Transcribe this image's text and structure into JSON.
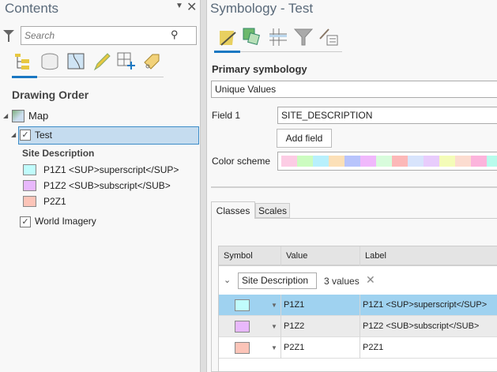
{
  "contents": {
    "title": "Contents",
    "search_placeholder": "Search",
    "section": "Drawing Order",
    "tree": {
      "map": "Map",
      "layer": "Test",
      "legend_heading": "Site Description",
      "legend": [
        {
          "label": "P1Z1 <SUP>superscript</SUP>",
          "color": "#c0fcfc"
        },
        {
          "label": "P1Z2 <SUB>subscript</SUB>",
          "color": "#e8b8fc"
        },
        {
          "label": "P2Z1",
          "color": "#fcc4b8"
        }
      ],
      "basemap": "World Imagery"
    }
  },
  "symbology": {
    "title": "Symbology - Test",
    "primary_label": "Primary symbology",
    "renderer": "Unique Values",
    "field1_label": "Field 1",
    "field1_value": "SITE_DESCRIPTION",
    "add_field": "Add field",
    "color_scheme_label": "Color scheme",
    "color_scheme": [
      "#fccce4",
      "#ccfcc0",
      "#b8f0fc",
      "#fce0b8",
      "#b8c4fc",
      "#f0b8fc",
      "#d8fcdc",
      "#fcb8b8",
      "#d8e4fc",
      "#e8ccfc",
      "#f4fcb8",
      "#fcdcd0",
      "#fcb4dc",
      "#b8fcec"
    ],
    "tabs": [
      "Classes",
      "Scales"
    ],
    "table": {
      "headers": [
        "Symbol",
        "Value",
        "Label"
      ],
      "group": "Site Description",
      "count": "3 values",
      "rows": [
        {
          "value": "P1Z1",
          "label": "P1Z1 <SUP>superscript</SUP>",
          "color": "#c0fcfc",
          "selected": true
        },
        {
          "value": "P1Z2",
          "label": "P1Z2 <SUB>subscript</SUB>",
          "color": "#e8b8fc"
        },
        {
          "value": "P2Z1",
          "label": "P2Z1",
          "color": "#fcc4b8"
        }
      ]
    }
  },
  "colors": {
    "accent": "#1a78c2",
    "selection": "#9fd2f0",
    "tree_selection": "#c5dcef"
  }
}
